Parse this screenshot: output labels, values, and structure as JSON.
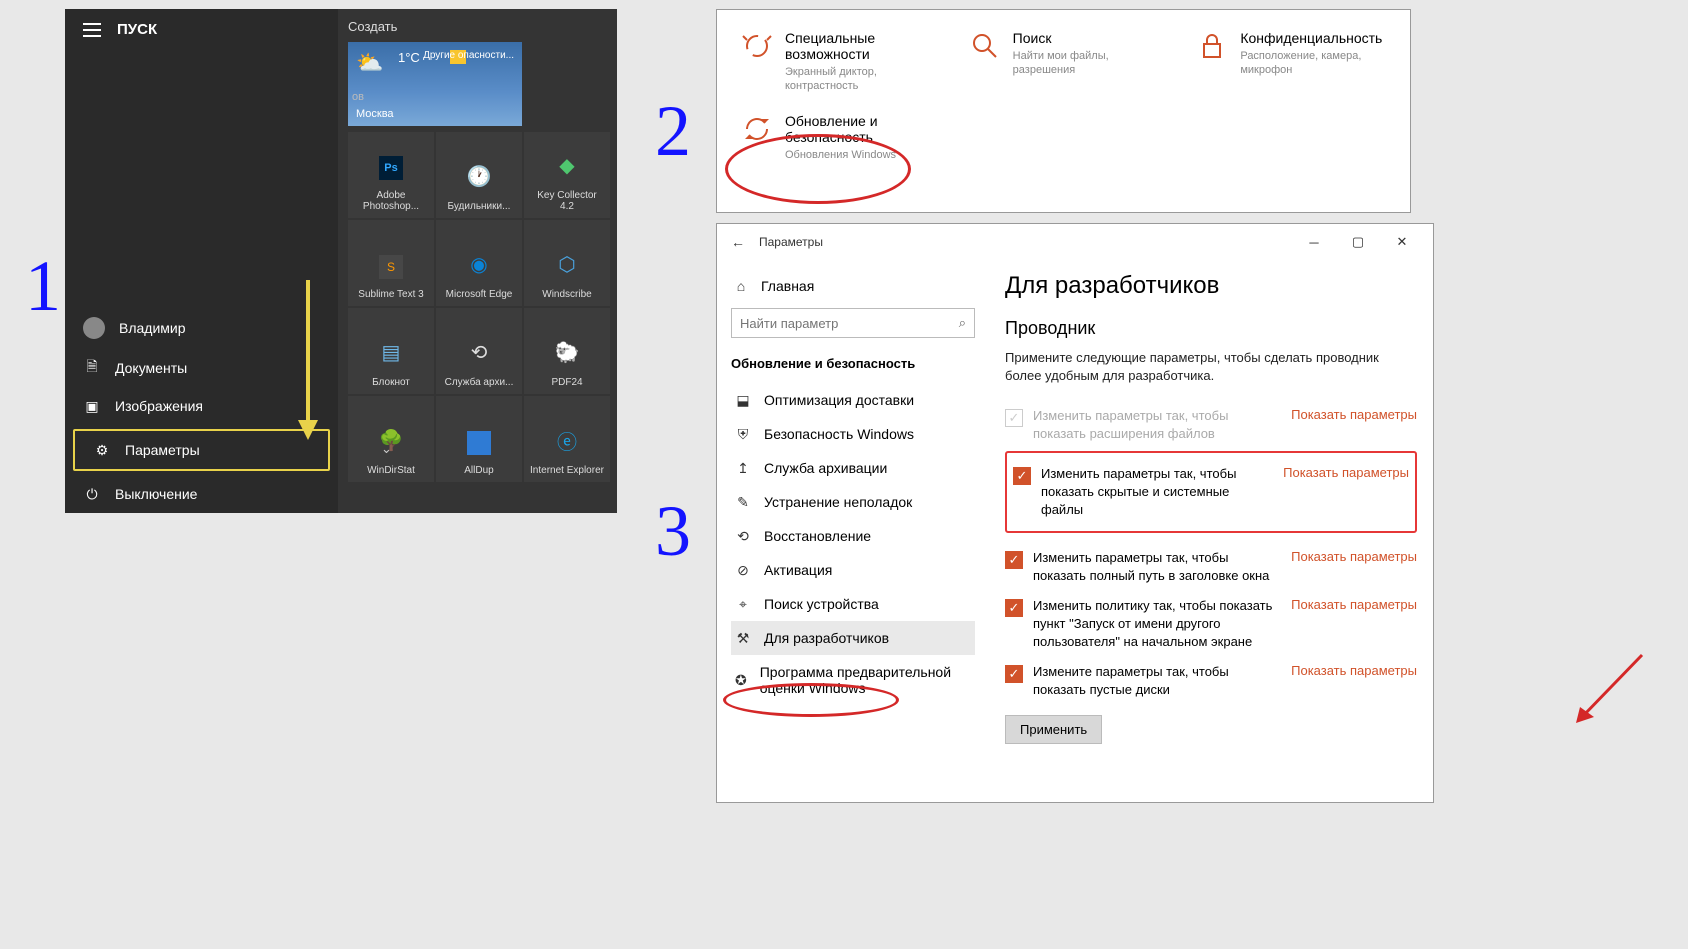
{
  "steps": {
    "n1": "1",
    "n2": "2",
    "n3": "3"
  },
  "start": {
    "title": "ПУСК",
    "ov": "ов",
    "user": "Владимир",
    "items": {
      "docs": "Документы",
      "pics": "Изображения",
      "settings": "Параметры",
      "power": "Выключение"
    },
    "create": "Создать",
    "weather": {
      "city": "Москва",
      "temp": "1°C",
      "warn": "Другие опасности..."
    },
    "tiles": [
      {
        "label": "Adobe Photoshop..."
      },
      {
        "label": "Будильники..."
      },
      {
        "label": "Key Collector 4.2"
      },
      {
        "label": "Sublime Text 3"
      },
      {
        "label": "Microsoft Edge"
      },
      {
        "label": "Windscribe"
      },
      {
        "label": "Блокнот"
      },
      {
        "label": "Служба архи..."
      },
      {
        "label": "PDF24"
      },
      {
        "label": "WinDirStat"
      },
      {
        "label": "AllDup"
      },
      {
        "label": "Internet Explorer"
      }
    ]
  },
  "catpanel": {
    "cats": [
      {
        "t": "Специальные возможности",
        "d": "Экранный диктор, контрастность"
      },
      {
        "t": "Поиск",
        "d": "Найти мои файлы, разрешения"
      },
      {
        "t": "Конфиденциальность",
        "d": "Расположение, камера, микрофон"
      }
    ],
    "update": {
      "t": "Обновление и безопасность",
      "d": "Обновления Windows"
    }
  },
  "win3": {
    "title": "Параметры",
    "nav": {
      "home": "Главная",
      "search_ph": "Найти параметр",
      "head": "Обновление и безопасность",
      "items": [
        "Оптимизация доставки",
        "Безопасность Windows",
        "Служба архивации",
        "Устранение неполадок",
        "Восстановление",
        "Активация",
        "Поиск устройства",
        "Для разработчиков",
        "Программа предварительной оценки Windows"
      ]
    },
    "content": {
      "h1": "Для разработчиков",
      "h2": "Проводник",
      "desc": "Примените следующие параметры, чтобы сделать проводник более удобным для разработчика.",
      "show": "Показать параметры",
      "opts": [
        "Изменить параметры так, чтобы показать расширения файлов",
        "Изменить параметры так, чтобы показать скрытые и системные файлы",
        "Изменить параметры так, чтобы показать полный путь в заголовке окна",
        "Изменить политику так, чтобы показать пункт \"Запуск от имени другого пользователя\" на начальном экране",
        "Измените параметры так, чтобы показать пустые диски"
      ],
      "apply": "Применить"
    }
  }
}
